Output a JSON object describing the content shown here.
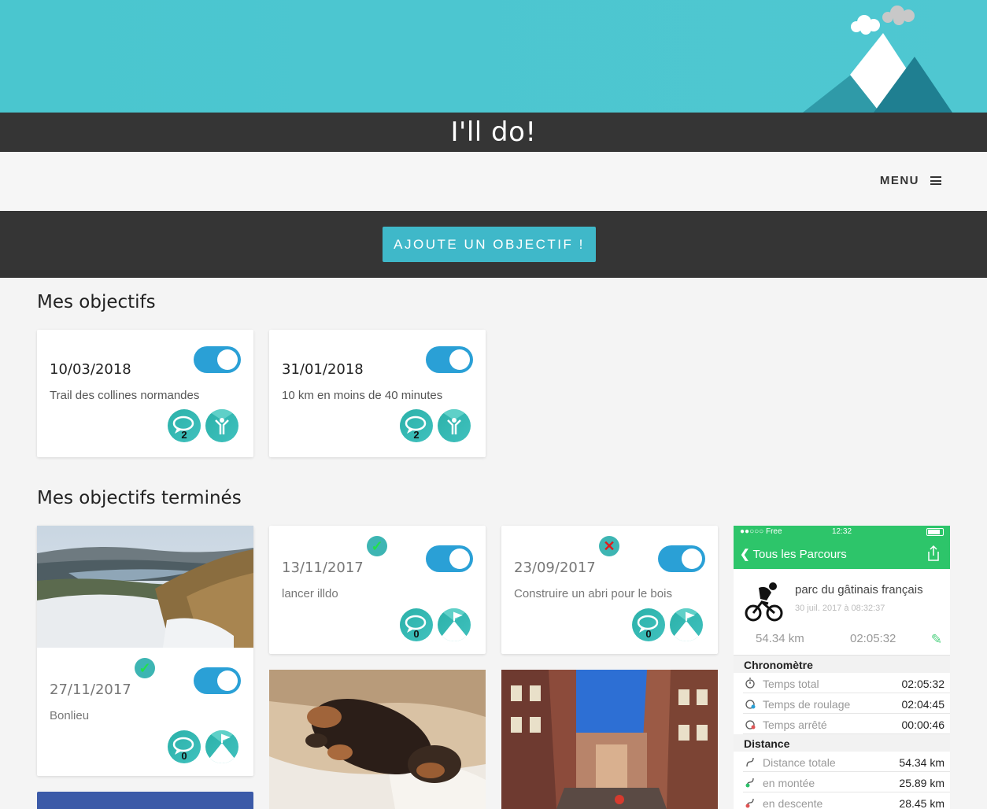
{
  "app": {
    "title": "I'll do!"
  },
  "nav": {
    "menu_label": "MENU"
  },
  "actions": {
    "add_goal": "AJOUTE UN OBJECTIF !"
  },
  "sections": {
    "active": "Mes objectifs",
    "done": "Mes objectifs terminés"
  },
  "active_goals": [
    {
      "date": "10/03/2018",
      "title": "Trail des collines normandes",
      "comments": "2"
    },
    {
      "date": "31/01/2018",
      "title": "10 km en moins de 40 minutes",
      "comments": "2"
    }
  ],
  "done_goals": [
    {
      "date": "27/11/2017",
      "title": "Bonlieu",
      "comments": "0",
      "result": "success"
    },
    {
      "date": "13/11/2017",
      "title": "lancer illdo",
      "comments": "0",
      "result": "success"
    },
    {
      "date": "23/09/2017",
      "title": "Construire un abri pour le bois",
      "comments": "0",
      "result": "failure"
    }
  ],
  "phone": {
    "carrier": "●●○○○ Free",
    "time": "12:32",
    "back_label": "Tous les Parcours",
    "route_name": "parc du gâtinais français",
    "route_date": "30 juil. 2017 à 08:32:37",
    "distance": "54.34 km",
    "duration": "02:05:32",
    "sections": [
      {
        "title": "Chronomètre",
        "rows": [
          {
            "label": "Temps total",
            "value": "02:05:32"
          },
          {
            "label": "Temps de roulage",
            "value": "02:04:45"
          },
          {
            "label": "Temps arrêté",
            "value": "00:00:46"
          }
        ]
      },
      {
        "title": "Distance",
        "rows": [
          {
            "label": "Distance totale",
            "value": "54.34 km"
          },
          {
            "label": "en montée",
            "value": "25.89 km"
          },
          {
            "label": "en descente",
            "value": "28.45 km"
          }
        ]
      }
    ]
  },
  "colors": {
    "teal": "#4ac6cf",
    "dark": "#353535",
    "toggle": "#2aa0d6",
    "green": "#2dc56a"
  }
}
